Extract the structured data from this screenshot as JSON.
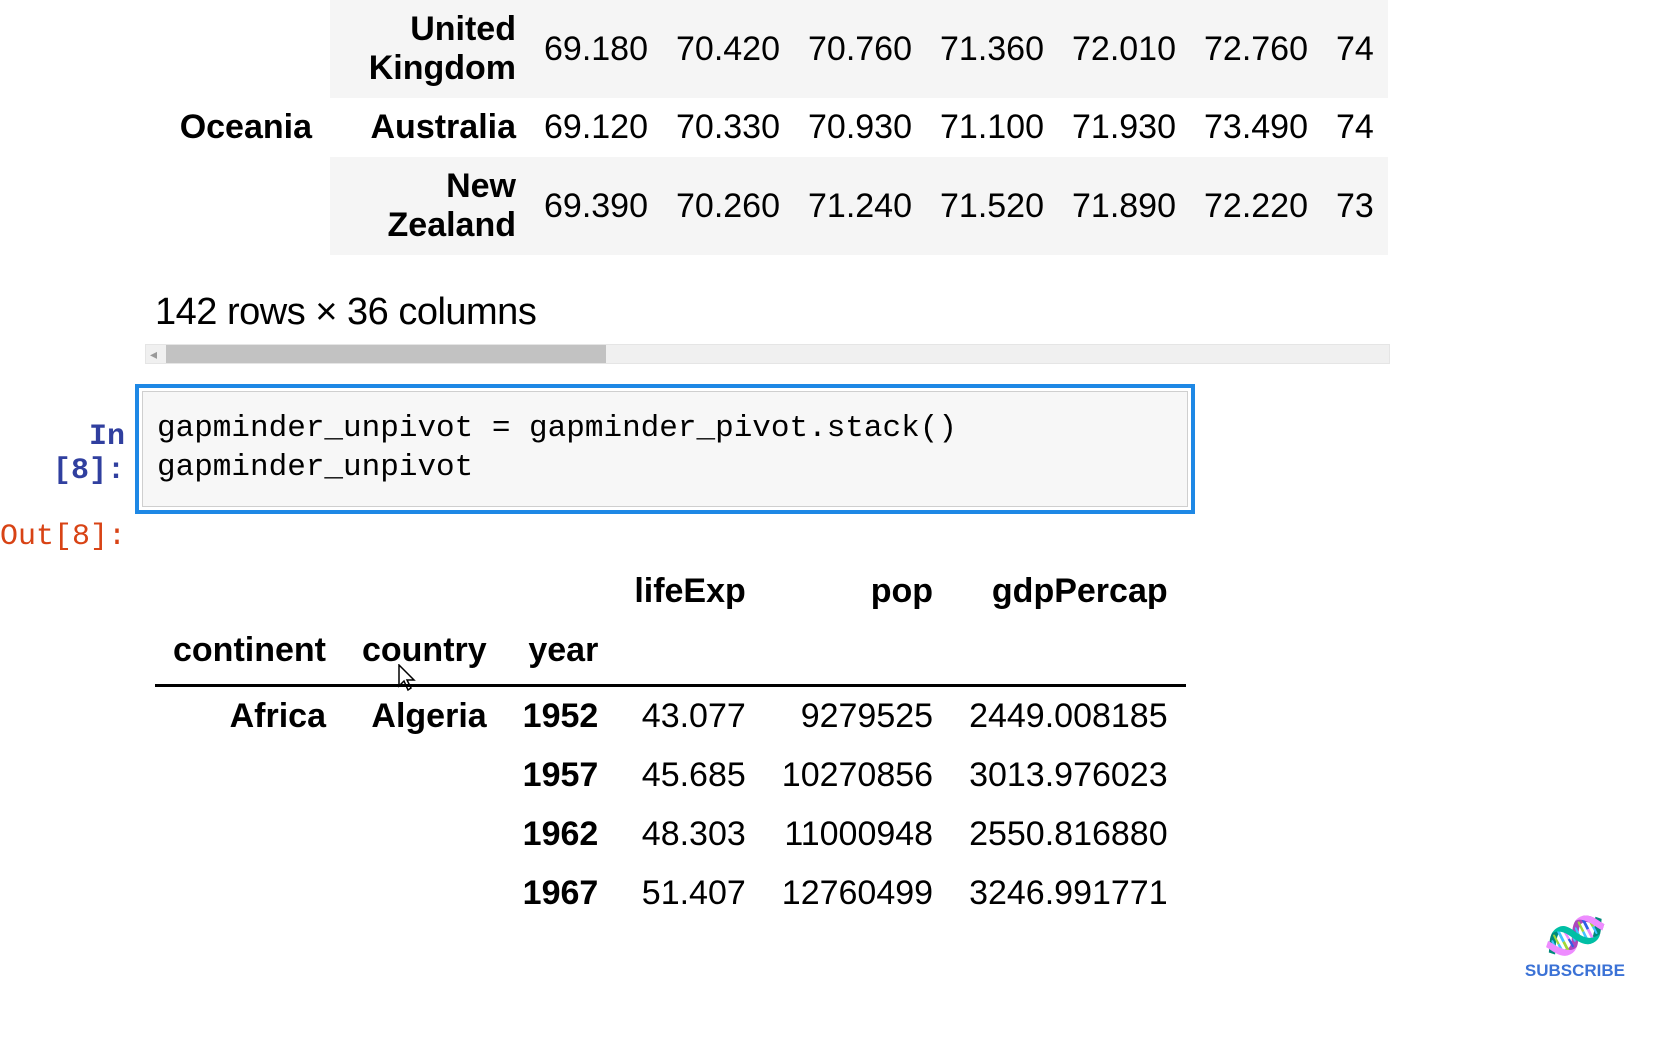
{
  "upper_table": {
    "rows": [
      {
        "continent": "",
        "country": "United Kingdom",
        "values": [
          "69.180",
          "70.420",
          "70.760",
          "71.360",
          "72.010",
          "72.760",
          "74"
        ]
      },
      {
        "continent": "Oceania",
        "country": "Australia",
        "values": [
          "69.120",
          "70.330",
          "70.930",
          "71.100",
          "71.930",
          "73.490",
          "74"
        ]
      },
      {
        "continent": "",
        "country": "New Zealand",
        "values": [
          "69.390",
          "70.260",
          "71.240",
          "71.520",
          "71.890",
          "72.220",
          "73"
        ]
      }
    ]
  },
  "dims_text": "142 rows × 36 columns",
  "cell": {
    "in_prompt": "In [8]:",
    "code": "gapminder_unpivot = gapminder_pivot.stack()\ngapminder_unpivot",
    "out_prompt": "Out[8]:"
  },
  "lower_table": {
    "header_top": [
      "",
      "",
      "",
      "lifeExp",
      "pop",
      "gdpPercap"
    ],
    "header_bottom": [
      "continent",
      "country",
      "year",
      "",
      "",
      ""
    ],
    "rows": [
      {
        "continent": "Africa",
        "country": "Algeria",
        "year": "1952",
        "lifeExp": "43.077",
        "pop": "9279525",
        "gdpPercap": "2449.008185"
      },
      {
        "continent": "",
        "country": "",
        "year": "1957",
        "lifeExp": "45.685",
        "pop": "10270856",
        "gdpPercap": "3013.976023"
      },
      {
        "continent": "",
        "country": "",
        "year": "1962",
        "lifeExp": "48.303",
        "pop": "11000948",
        "gdpPercap": "2550.816880"
      },
      {
        "continent": "",
        "country": "",
        "year": "1967",
        "lifeExp": "51.407",
        "pop": "12760499",
        "gdpPercap": "3246.991771"
      }
    ]
  },
  "subscribe_label": "SUBSCRIBE"
}
